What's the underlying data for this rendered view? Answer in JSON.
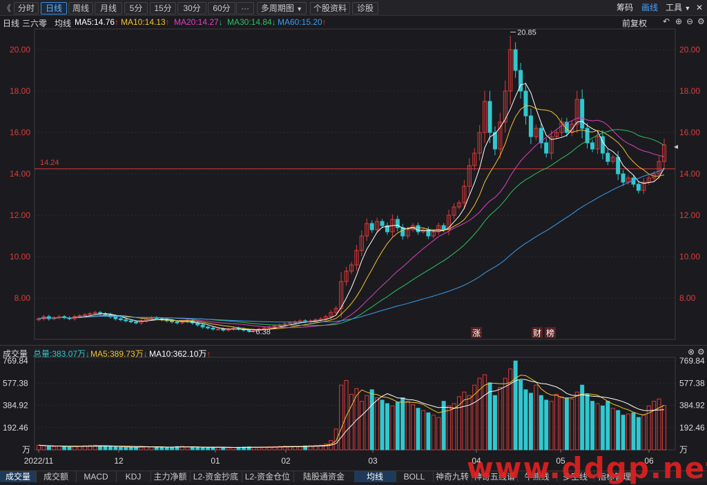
{
  "toolbar": {
    "collapse": "《",
    "periods": [
      "分时",
      "日线",
      "周线",
      "月线",
      "5分",
      "15分",
      "30分",
      "60分",
      "···"
    ],
    "active_period": "日线",
    "multi_period": "多周期图",
    "stock_info": "个股资料",
    "diagnose": "诊股",
    "right": {
      "chips": "筹码",
      "draw": "画线",
      "tools": "工具"
    }
  },
  "main_header": {
    "period": "日线",
    "stock_name": "三六零",
    "avg_label": "均线",
    "ma": [
      {
        "label": "MA5:14.76",
        "arrow": "↑",
        "color": "#ffffff"
      },
      {
        "label": "MA10:14.13",
        "arrow": "↑",
        "color": "#f4c430"
      },
      {
        "label": "MA20:14.27",
        "arrow": "↓",
        "color": "#e040c0"
      },
      {
        "label": "MA30:14.84",
        "arrow": "↓",
        "color": "#30c060"
      },
      {
        "label": "MA60:15.20",
        "arrow": "↑",
        "color": "#3a9cf0"
      }
    ],
    "adjust": "前复权"
  },
  "chart_data": [
    {
      "type": "candlestick",
      "title": "日线",
      "ylim": [
        6.0,
        21.0
      ],
      "yticks": [
        20.0,
        18.0,
        16.0,
        14.0,
        12.0,
        10.0,
        8.0
      ],
      "ytick_labels": [
        "20.00",
        "18.00",
        "16.00",
        "14.00",
        "12.00",
        "10.00",
        "8.00"
      ],
      "x_tick_labels": [
        "2022/11",
        "12",
        "01",
        "02",
        "03",
        "04",
        "05",
        "06"
      ],
      "current_price_line": {
        "value": 14.24,
        "label": "14.24"
      },
      "annotations": [
        {
          "label": "20.85",
          "value": 20.85,
          "type": "high"
        },
        {
          "label": "6.38",
          "value": 6.38,
          "type": "low"
        }
      ],
      "markers": [
        "涨",
        "财",
        "榜"
      ],
      "ma_series": [
        {
          "name": "MA5",
          "color": "#ffffff",
          "value": 14.76
        },
        {
          "name": "MA10",
          "color": "#f4c430",
          "value": 14.13
        },
        {
          "name": "MA20",
          "color": "#e040c0",
          "value": 14.27
        },
        {
          "name": "MA30",
          "color": "#30c060",
          "value": 14.84
        },
        {
          "name": "MA60",
          "color": "#3a9cf0",
          "value": 15.2
        }
      ],
      "up_color": "#e03a3a",
      "down_color": "#30c8d0",
      "closes": [
        7.0,
        7.1,
        7.0,
        7.05,
        7.1,
        7.05,
        7.0,
        7.1,
        7.15,
        7.2,
        7.25,
        7.3,
        7.25,
        7.2,
        7.1,
        7.0,
        6.95,
        6.9,
        6.85,
        6.8,
        6.9,
        7.0,
        7.05,
        7.0,
        6.95,
        6.9,
        6.85,
        6.8,
        6.85,
        6.9,
        6.8,
        6.7,
        6.6,
        6.55,
        6.5,
        6.5,
        6.45,
        6.5,
        6.55,
        6.5,
        6.45,
        6.4,
        6.45,
        6.5,
        6.55,
        6.6,
        6.65,
        6.7,
        6.75,
        6.8,
        6.85,
        6.9,
        6.85,
        6.9,
        6.95,
        7.0,
        7.1,
        7.3,
        7.5,
        8.8,
        9.3,
        9.6,
        10.3,
        11.0,
        11.6,
        11.3,
        11.7,
        11.5,
        11.2,
        11.8,
        11.4,
        11.0,
        11.3,
        11.5,
        11.2,
        11.3,
        11.0,
        11.2,
        11.5,
        11.3,
        12.0,
        12.4,
        12.6,
        13.4,
        14.4,
        15.0,
        16.0,
        17.5,
        16.0,
        15.2,
        16.5,
        18.0,
        20.0,
        19.0,
        18.0,
        16.8,
        15.8,
        16.2,
        15.5,
        15.0,
        15.8,
        16.0,
        16.5,
        16.0,
        16.4,
        17.6,
        16.2,
        15.5,
        15.2,
        15.8,
        15.0,
        14.6,
        14.8,
        14.0,
        13.6,
        13.8,
        13.5,
        13.2,
        13.6,
        13.8,
        14.0,
        14.6,
        15.4
      ]
    },
    {
      "type": "bar",
      "title": "成交量",
      "unit": "万",
      "ylim": [
        0,
        800
      ],
      "yticks": [
        769.84,
        577.38,
        384.92,
        192.46
      ],
      "ytick_labels": [
        "769.84",
        "577.38",
        "384.92",
        "192.46"
      ],
      "x_tick_labels": [
        "2022/11",
        "12",
        "01",
        "02",
        "03",
        "04",
        "05",
        "06"
      ],
      "legend": [
        {
          "label": "总量:383.07万",
          "arrow": "↓",
          "color": "#30c8d0"
        },
        {
          "label": "MA5:389.73万",
          "arrow": "↓",
          "color": "#f4c430"
        },
        {
          "label": "MA10:362.10万",
          "arrow": "↑",
          "color": "#ffffff"
        }
      ],
      "values": [
        40,
        35,
        30,
        28,
        32,
        30,
        25,
        28,
        30,
        35,
        38,
        40,
        36,
        30,
        28,
        25,
        22,
        20,
        22,
        25,
        30,
        28,
        26,
        24,
        22,
        20,
        24,
        28,
        30,
        26,
        22,
        20,
        18,
        20,
        22,
        24,
        20,
        18,
        20,
        22,
        24,
        26,
        22,
        20,
        24,
        26,
        28,
        30,
        32,
        30,
        28,
        30,
        34,
        36,
        38,
        40,
        50,
        80,
        180,
        560,
        600,
        480,
        530,
        420,
        470,
        520,
        450,
        430,
        400,
        380,
        410,
        450,
        420,
        390,
        360,
        340,
        320,
        300,
        280,
        420,
        380,
        400,
        460,
        500,
        470,
        560,
        620,
        650,
        580,
        470,
        540,
        620,
        700,
        769,
        600,
        520,
        490,
        560,
        470,
        430,
        420,
        480,
        460,
        450,
        440,
        500,
        560,
        480,
        420,
        400,
        380,
        420,
        360,
        340,
        300,
        310,
        320,
        280,
        300,
        380,
        420,
        440,
        383
      ]
    }
  ],
  "vol_header": {
    "title": "成交量",
    "unit_label": "万"
  },
  "bottom_tabs": [
    "成交量",
    "成交额",
    "MACD",
    "KDJ",
    "主力净额",
    "L2-资金抄底",
    "L2-资金仓位",
    "陆股通资金",
    "均线",
    "BOLL",
    "神奇九转",
    "神奇五线谱",
    "牛熊线",
    "多空线",
    "指标管理"
  ],
  "active_tab": "成交量",
  "active_tab_2": "均线",
  "watermark": "www.ddgp.net"
}
